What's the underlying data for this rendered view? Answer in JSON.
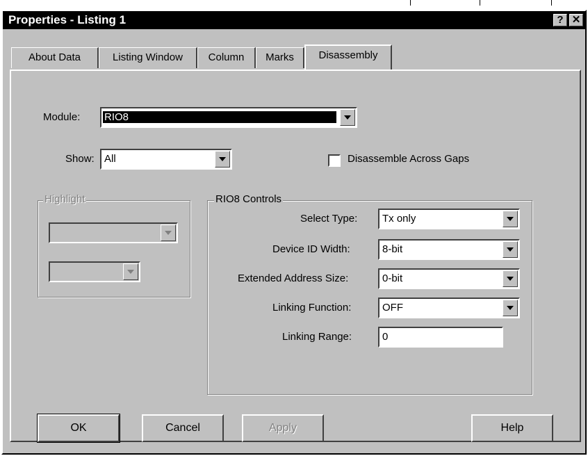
{
  "window": {
    "title": "Properties - Listing 1",
    "help_button": "?",
    "close_button": "✕"
  },
  "tabs": [
    {
      "label": "About Data"
    },
    {
      "label": "Listing Window"
    },
    {
      "label": "Column"
    },
    {
      "label": "Marks"
    },
    {
      "label": "Disassembly"
    }
  ],
  "module": {
    "label": "Module:",
    "value": "RIO8"
  },
  "show": {
    "label": "Show:",
    "value": "All"
  },
  "disassemble_across_gaps": {
    "label": "Disassemble Across Gaps",
    "checked": false
  },
  "highlight": {
    "title": "Highlight",
    "combo1": "",
    "combo2": ""
  },
  "controls": {
    "title": "RIO8 Controls",
    "select_type": {
      "label": "Select Type:",
      "value": "Tx only"
    },
    "device_id_width": {
      "label": "Device ID Width:",
      "value": "8-bit"
    },
    "extended_address_size": {
      "label": "Extended Address Size:",
      "value": "0-bit"
    },
    "linking_function": {
      "label": "Linking Function:",
      "value": "OFF"
    },
    "linking_range": {
      "label": "Linking Range:",
      "value": "0"
    }
  },
  "buttons": {
    "ok": "OK",
    "cancel": "Cancel",
    "apply": "Apply",
    "help": "Help"
  }
}
